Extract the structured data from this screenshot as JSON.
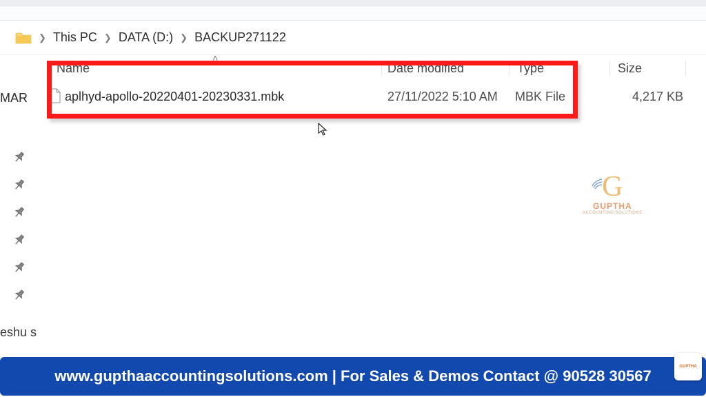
{
  "breadcrumb": {
    "root": "This PC",
    "drive": "DATA (D:)",
    "folder": "BACKUP271122"
  },
  "columns": {
    "name": "Name",
    "date": "Date modified",
    "type": "Type",
    "size": "Size"
  },
  "file": {
    "name": "aplhyd-apollo-20220401-20230331.mbk",
    "date": "27/11/2022 5:10 AM",
    "type": "MBK File",
    "size": "4,217 KB"
  },
  "left_fragments": {
    "mar": "MAR ",
    "eshu": "eshu s"
  },
  "watermark": {
    "brand": "GUPTHA",
    "tag": "ACCOUNTING SOLUTIONS"
  },
  "footer": "www.gupthaaccountingsolutions.com | For Sales & Demos Contact @ 90528 30567",
  "footer_badge": "GUPTHA"
}
